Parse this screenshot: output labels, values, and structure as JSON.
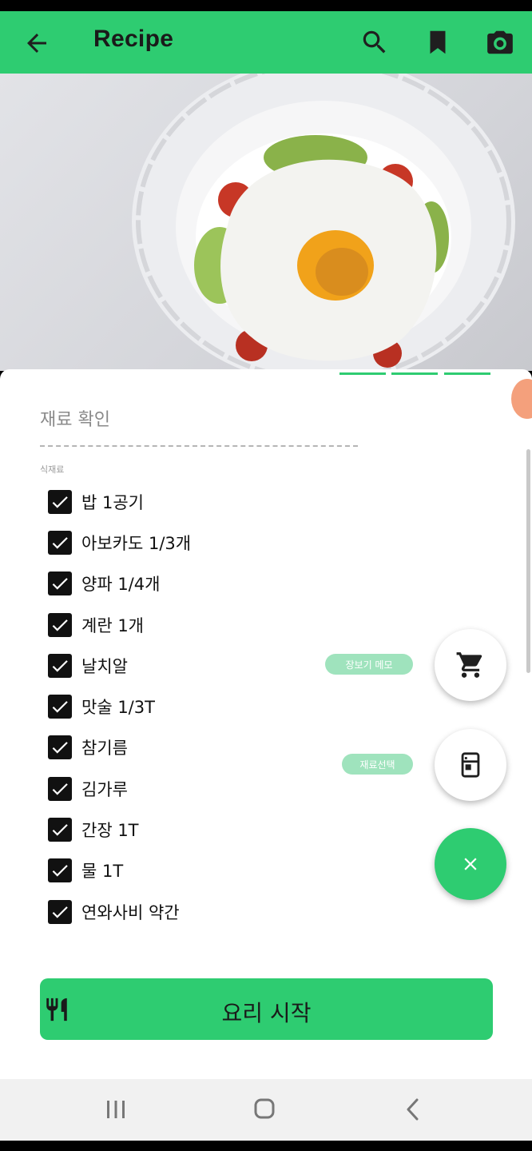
{
  "app": {
    "title": "Recipe",
    "accent": "#2ecc71"
  },
  "appbar_icons": [
    "back-arrow-icon",
    "search-icon",
    "bookmark-icon",
    "camera-icon"
  ],
  "section": {
    "title": "재료 확인",
    "sub_label": "식재료"
  },
  "ingredients": [
    {
      "label": "밥 1공기",
      "checked": true
    },
    {
      "label": "아보카도 1/3개",
      "checked": true
    },
    {
      "label": "양파 1/4개",
      "checked": true
    },
    {
      "label": "계란 1개",
      "checked": true
    },
    {
      "label": "날치알",
      "checked": true
    },
    {
      "label": "맛술 1/3T",
      "checked": true
    },
    {
      "label": "참기름",
      "checked": true
    },
    {
      "label": "김가루",
      "checked": true
    },
    {
      "label": "간장 1T",
      "checked": true
    },
    {
      "label": "물 1T",
      "checked": true
    },
    {
      "label": "연와사비 약간",
      "checked": true
    }
  ],
  "fabs": {
    "shopping_label": "장보기 메모",
    "ingredient_label": "재료선택",
    "shopping_icon": "cart-icon",
    "ingredient_icon": "fridge-icon",
    "close_icon": "close-icon"
  },
  "start_button": {
    "label": "요리 시작",
    "icon": "utensils-icon"
  },
  "navbar_icons": [
    "recent-apps-icon",
    "home-icon",
    "nav-back-icon"
  ]
}
